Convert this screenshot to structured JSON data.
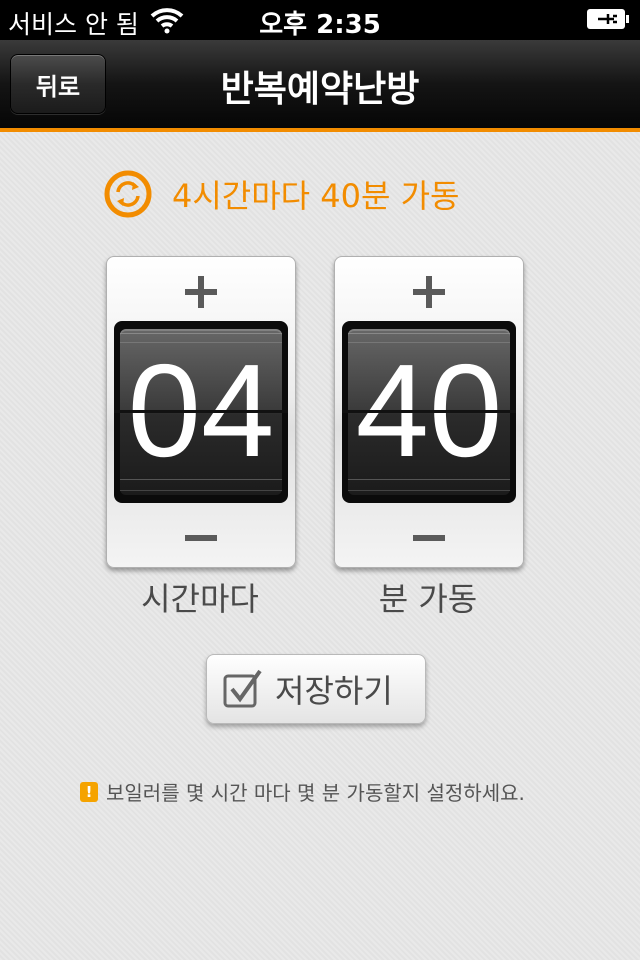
{
  "status_bar": {
    "carrier": "서비스 안 됨",
    "time": "오후 2:35",
    "wifi_icon": "wifi-icon",
    "battery_icon": "battery-charging-icon"
  },
  "nav": {
    "back_label": "뒤로",
    "title": "반복예약난방"
  },
  "summary": {
    "icon": "repeat-icon",
    "text": "4시간마다 40분 가동"
  },
  "pickers": {
    "hours": {
      "value": "04",
      "label": "시간마다",
      "plus_icon": "plus-icon",
      "minus_icon": "minus-icon"
    },
    "minutes": {
      "value": "40",
      "label": "분 가동",
      "plus_icon": "plus-icon",
      "minus_icon": "minus-icon"
    }
  },
  "save": {
    "label": "저장하기",
    "icon": "checkbox-icon"
  },
  "hint": {
    "icon": "warning-icon",
    "text": "보일러를 몇 시간 마다 몇 분 가동할지 설정하세요."
  },
  "colors": {
    "accent": "#f28c00",
    "navbar": "#141414",
    "background": "#e6e6e6"
  }
}
